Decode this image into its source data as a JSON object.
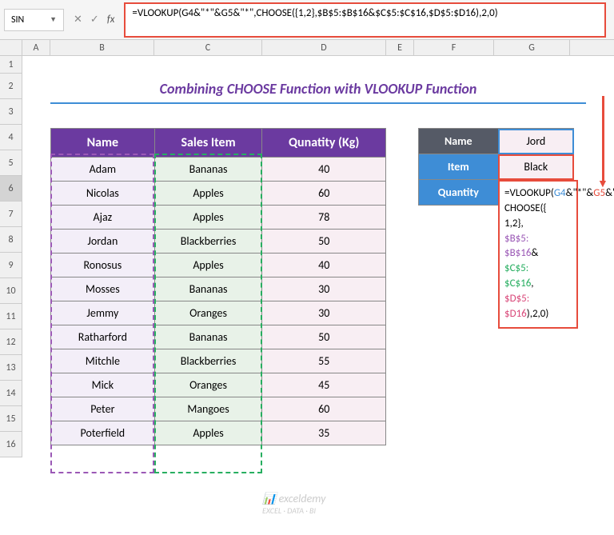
{
  "nameBox": "SIN",
  "formula": "=VLOOKUP(G4&\"*\"&G5&\"*\",CHOOSE({1,2},$B$5:$B$16&$C$5:$C$16,$D$5:$D16),2,0)",
  "title": "Combining CHOOSE Function with VLOOKUP Function",
  "cols": [
    "A",
    "B",
    "C",
    "D",
    "E",
    "F",
    "G"
  ],
  "rows": [
    "1",
    "2",
    "3",
    "4",
    "5",
    "6",
    "7",
    "8",
    "9",
    "10",
    "11",
    "12",
    "13",
    "14",
    "15",
    "16"
  ],
  "headers": {
    "name": "Name",
    "item": "Sales Item",
    "qty": "Qunatity (Kg)"
  },
  "data": [
    {
      "name": "Adam",
      "item": "Bananas",
      "qty": "40"
    },
    {
      "name": "Nicolas",
      "item": "Apples",
      "qty": "60"
    },
    {
      "name": "Ajaz",
      "item": "Apples",
      "qty": "78"
    },
    {
      "name": "Jordan",
      "item": "Blackberries",
      "qty": "50"
    },
    {
      "name": "Ronosus",
      "item": "Apples",
      "qty": "40"
    },
    {
      "name": "Mosses",
      "item": "Bananas",
      "qty": "30"
    },
    {
      "name": "Jemmy",
      "item": "Oranges",
      "qty": "30"
    },
    {
      "name": "Ratharford",
      "item": "Bananas",
      "qty": "50"
    },
    {
      "name": "Mitchle",
      "item": "Blackberries",
      "qty": "55"
    },
    {
      "name": "Mick",
      "item": "Oranges",
      "qty": "45"
    },
    {
      "name": "Peter",
      "item": "Mangoes",
      "qty": "60"
    },
    {
      "name": "Poterfield",
      "item": "Apples",
      "qty": "35"
    }
  ],
  "side": {
    "nameLabel": "Name",
    "nameVal": "Jord",
    "itemLabel": "Item",
    "itemVal": "Black",
    "qtyLabel": "Quantity"
  },
  "g6": {
    "p1": "=VLOOKUP(",
    "p2": "G4",
    "p3": "&\"*\"&",
    "p4": "G5",
    "p5": "&\"*\",",
    "p6": "CHOOSE({",
    "p7": "1,2},",
    "p8": "$B$5:",
    "p9": "$B$16",
    "p10": "&",
    "p11": "$C$5:",
    "p12": "$C$16",
    "p13": ",",
    "p14": "$D$5:",
    "p15": "$D16",
    "p16": "),2,0)"
  },
  "watermark": {
    "brand": "exceldemy",
    "tag": "EXCEL · DATA · BI"
  }
}
